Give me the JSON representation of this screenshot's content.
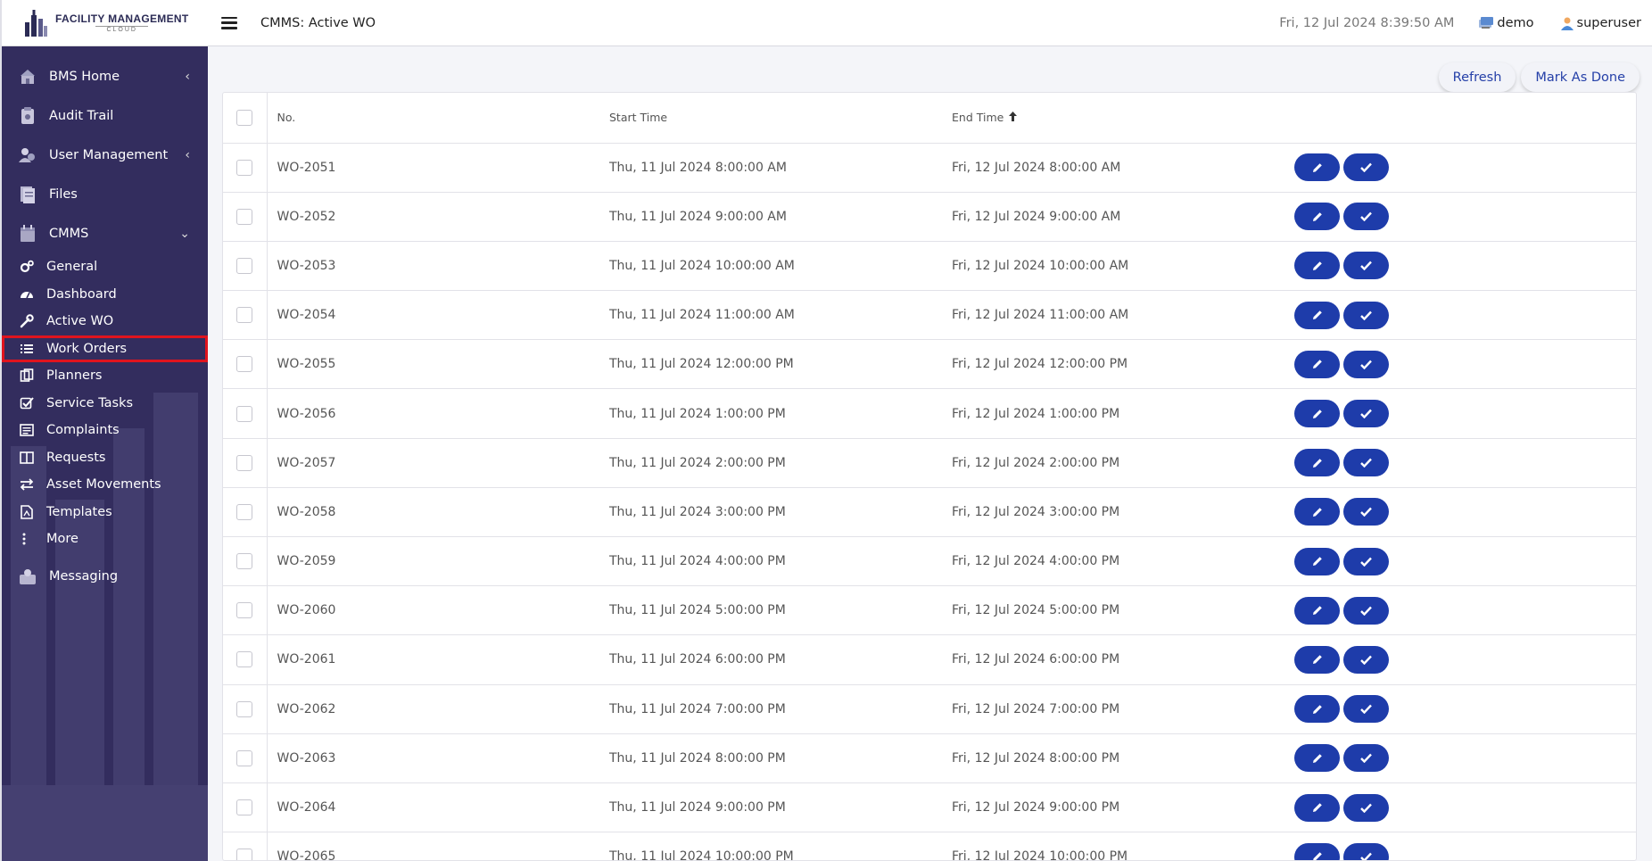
{
  "brand": {
    "title": "FACILITY MANAGEMENT",
    "subtitle": "CLOUD"
  },
  "topbar": {
    "page_title": "CMMS: Active WO",
    "datetime": "Fri, 12 Jul 2024 8:39:50 AM",
    "site": "demo",
    "user": "superuser"
  },
  "sidebar": {
    "items": [
      {
        "label": "BMS Home",
        "icon": "bms-home-icon",
        "chevron": "‹"
      },
      {
        "label": "Audit Trail",
        "icon": "audit-trail-icon"
      },
      {
        "label": "User Management",
        "icon": "user-management-icon",
        "chevron": "‹"
      },
      {
        "label": "Files",
        "icon": "files-icon"
      },
      {
        "label": "CMMS",
        "icon": "cmms-icon",
        "chevron": "⌄"
      }
    ],
    "cmms_sub": [
      {
        "label": "General",
        "icon": "cogs-icon"
      },
      {
        "label": "Dashboard",
        "icon": "dashboard-icon"
      },
      {
        "label": "Active WO",
        "icon": "wrench-icon"
      },
      {
        "label": "Work Orders",
        "icon": "list-icon"
      },
      {
        "label": "Planners",
        "icon": "planners-icon"
      },
      {
        "label": "Service Tasks",
        "icon": "check-square-icon"
      },
      {
        "label": "Complaints",
        "icon": "complaints-icon"
      },
      {
        "label": "Requests",
        "icon": "requests-icon"
      },
      {
        "label": "Asset Movements",
        "icon": "exchange-icon"
      },
      {
        "label": "Templates",
        "icon": "template-icon"
      },
      {
        "label": "More",
        "icon": "more-vertical-icon"
      }
    ],
    "messaging": {
      "label": "Messaging",
      "icon": "messaging-icon"
    }
  },
  "actions": {
    "refresh": "Refresh",
    "mark_done": "Mark As Done"
  },
  "table": {
    "columns": {
      "no": "No.",
      "start": "Start Time",
      "end": "End Time"
    },
    "rows": [
      {
        "no": "WO-2051",
        "start": "Thu, 11 Jul 2024 8:00:00 AM",
        "end": "Fri, 12 Jul 2024 8:00:00 AM"
      },
      {
        "no": "WO-2052",
        "start": "Thu, 11 Jul 2024 9:00:00 AM",
        "end": "Fri, 12 Jul 2024 9:00:00 AM"
      },
      {
        "no": "WO-2053",
        "start": "Thu, 11 Jul 2024 10:00:00 AM",
        "end": "Fri, 12 Jul 2024 10:00:00 AM"
      },
      {
        "no": "WO-2054",
        "start": "Thu, 11 Jul 2024 11:00:00 AM",
        "end": "Fri, 12 Jul 2024 11:00:00 AM"
      },
      {
        "no": "WO-2055",
        "start": "Thu, 11 Jul 2024 12:00:00 PM",
        "end": "Fri, 12 Jul 2024 12:00:00 PM"
      },
      {
        "no": "WO-2056",
        "start": "Thu, 11 Jul 2024 1:00:00 PM",
        "end": "Fri, 12 Jul 2024 1:00:00 PM"
      },
      {
        "no": "WO-2057",
        "start": "Thu, 11 Jul 2024 2:00:00 PM",
        "end": "Fri, 12 Jul 2024 2:00:00 PM"
      },
      {
        "no": "WO-2058",
        "start": "Thu, 11 Jul 2024 3:00:00 PM",
        "end": "Fri, 12 Jul 2024 3:00:00 PM"
      },
      {
        "no": "WO-2059",
        "start": "Thu, 11 Jul 2024 4:00:00 PM",
        "end": "Fri, 12 Jul 2024 4:00:00 PM"
      },
      {
        "no": "WO-2060",
        "start": "Thu, 11 Jul 2024 5:00:00 PM",
        "end": "Fri, 12 Jul 2024 5:00:00 PM"
      },
      {
        "no": "WO-2061",
        "start": "Thu, 11 Jul 2024 6:00:00 PM",
        "end": "Fri, 12 Jul 2024 6:00:00 PM"
      },
      {
        "no": "WO-2062",
        "start": "Thu, 11 Jul 2024 7:00:00 PM",
        "end": "Fri, 12 Jul 2024 7:00:00 PM"
      },
      {
        "no": "WO-2063",
        "start": "Thu, 11 Jul 2024 8:00:00 PM",
        "end": "Fri, 12 Jul 2024 8:00:00 PM"
      },
      {
        "no": "WO-2064",
        "start": "Thu, 11 Jul 2024 9:00:00 PM",
        "end": "Fri, 12 Jul 2024 9:00:00 PM"
      },
      {
        "no": "WO-2065",
        "start": "Thu, 11 Jul 2024 10:00:00 PM",
        "end": "Fri, 12 Jul 2024 10:00:00 PM"
      }
    ]
  },
  "colors": {
    "sidebar_bg": "#332d5e",
    "action_btn": "#1e3caa",
    "highlight": "#e0141e"
  }
}
